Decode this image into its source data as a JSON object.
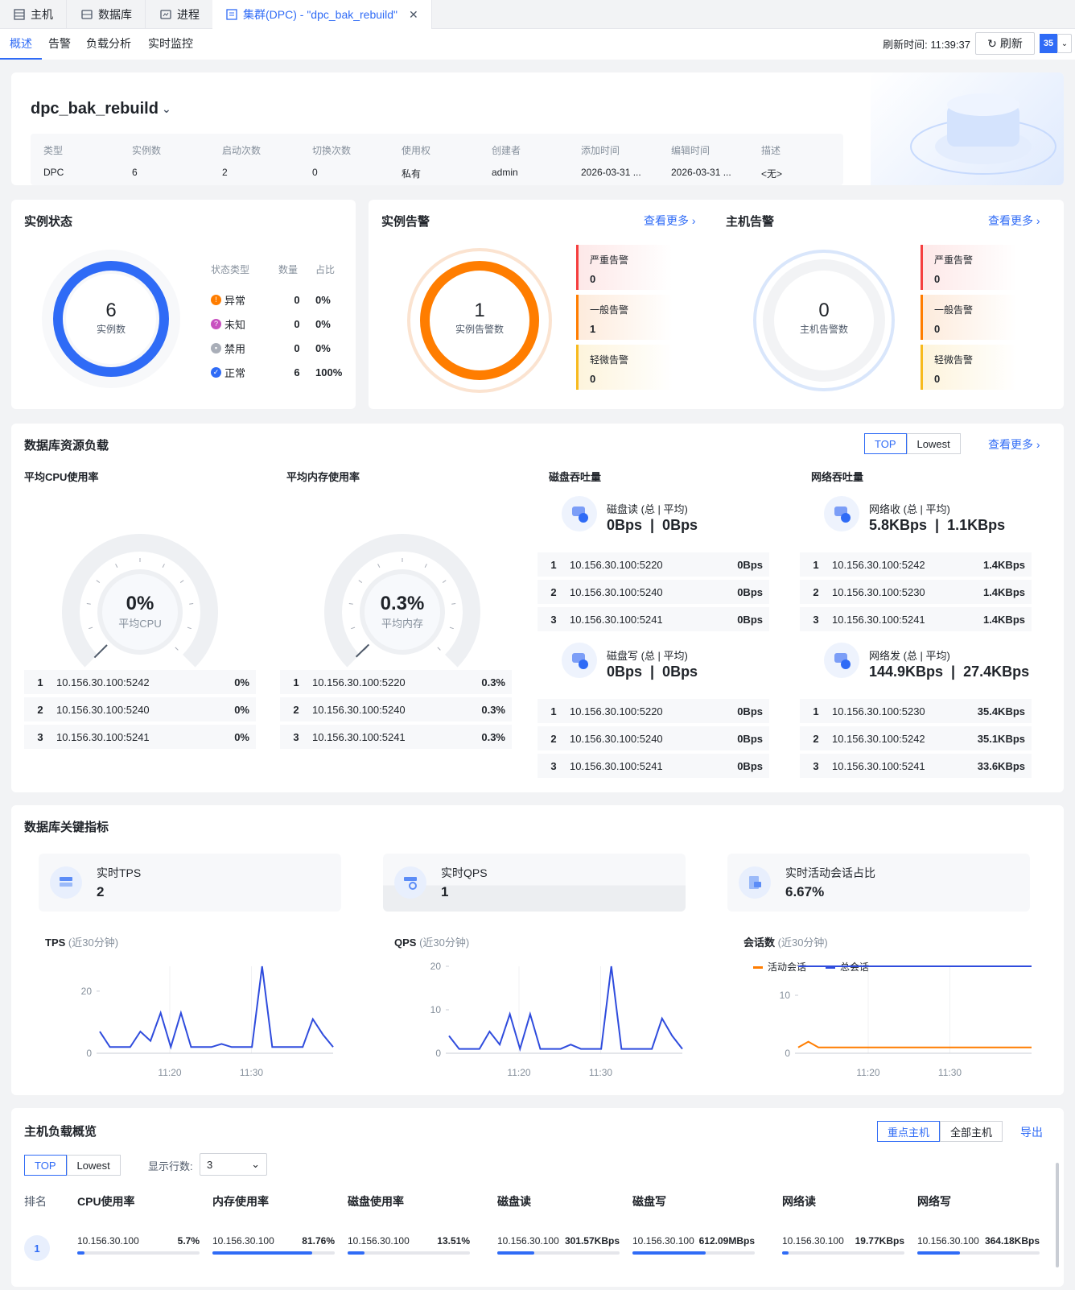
{
  "tabs": [
    {
      "label": "主机"
    },
    {
      "label": "数据库"
    },
    {
      "label": "进程"
    },
    {
      "label": "集群(DPC) - \"dpc_bak_rebuild\""
    }
  ],
  "subtabs": [
    "概述",
    "告警",
    "负载分析",
    "实时监控"
  ],
  "refresh": {
    "label": "刷新时间: 11:39:37",
    "button": "刷新",
    "interval": "35"
  },
  "cluster": {
    "name": "dpc_bak_rebuild",
    "info": [
      {
        "k": "类型",
        "v": "DPC"
      },
      {
        "k": "实例数",
        "v": "6"
      },
      {
        "k": "启动次数",
        "v": "2"
      },
      {
        "k": "切换次数",
        "v": "0"
      },
      {
        "k": "使用权",
        "v": "私有"
      },
      {
        "k": "创建者",
        "v": "admin"
      },
      {
        "k": "添加时间",
        "v": "2026-03-31 ..."
      },
      {
        "k": "编辑时间",
        "v": "2026-03-31 ..."
      },
      {
        "k": "描述",
        "v": "<无>"
      }
    ]
  },
  "instance_status": {
    "title": "实例状态",
    "count": "6",
    "count_label": "实例数",
    "headers": [
      "状态类型",
      "数量",
      "占比"
    ],
    "rows": [
      {
        "name": "异常",
        "count": "0",
        "pct": "0%",
        "color": "#ff7d00",
        "icon": "!"
      },
      {
        "name": "未知",
        "count": "0",
        "pct": "0%",
        "color": "#c850c0",
        "icon": "?"
      },
      {
        "name": "禁用",
        "count": "0",
        "pct": "0%",
        "color": "#a9aeb8",
        "icon": "▪"
      },
      {
        "name": "正常",
        "count": "6",
        "pct": "100%",
        "color": "#2f6bf6",
        "icon": "✓"
      }
    ]
  },
  "instance_alert": {
    "title": "实例告警",
    "more": "查看更多 ›",
    "count": "1",
    "count_label": "实例告警数",
    "items": [
      {
        "k": "严重告警",
        "v": "0"
      },
      {
        "k": "一般告警",
        "v": "1"
      },
      {
        "k": "轻微告警",
        "v": "0"
      }
    ]
  },
  "host_alert": {
    "title": "主机告警",
    "more": "查看更多 ›",
    "count": "0",
    "count_label": "主机告警数",
    "items": [
      {
        "k": "严重告警",
        "v": "0"
      },
      {
        "k": "一般告警",
        "v": "0"
      },
      {
        "k": "轻微告警",
        "v": "0"
      }
    ]
  },
  "db_load": {
    "title": "数据库资源负载",
    "seg": [
      "TOP",
      "Lowest"
    ],
    "more": "查看更多 ›",
    "cpu": {
      "title": "平均CPU使用率",
      "value": "0%",
      "label": "平均CPU",
      "level": 0,
      "rows": [
        {
          "r": "1",
          "ip": "10.156.30.100:5242",
          "v": "0%"
        },
        {
          "r": "2",
          "ip": "10.156.30.100:5240",
          "v": "0%"
        },
        {
          "r": "3",
          "ip": "10.156.30.100:5241",
          "v": "0%"
        }
      ]
    },
    "mem": {
      "title": "平均内存使用率",
      "value": "0.3%",
      "label": "平均内存",
      "level": 0.003,
      "rows": [
        {
          "r": "1",
          "ip": "10.156.30.100:5220",
          "v": "0.3%"
        },
        {
          "r": "2",
          "ip": "10.156.30.100:5240",
          "v": "0.3%"
        },
        {
          "r": "3",
          "ip": "10.156.30.100:5241",
          "v": "0.3%"
        }
      ]
    },
    "disk": {
      "title": "磁盘吞吐量",
      "read": {
        "label": "磁盘读 (总 | 平均)",
        "value": "0Bps  |  0Bps",
        "rows": [
          {
            "r": "1",
            "ip": "10.156.30.100:5220",
            "v": "0Bps"
          },
          {
            "r": "2",
            "ip": "10.156.30.100:5240",
            "v": "0Bps"
          },
          {
            "r": "3",
            "ip": "10.156.30.100:5241",
            "v": "0Bps"
          }
        ]
      },
      "write": {
        "label": "磁盘写 (总 | 平均)",
        "value": "0Bps  |  0Bps",
        "rows": [
          {
            "r": "1",
            "ip": "10.156.30.100:5220",
            "v": "0Bps"
          },
          {
            "r": "2",
            "ip": "10.156.30.100:5240",
            "v": "0Bps"
          },
          {
            "r": "3",
            "ip": "10.156.30.100:5241",
            "v": "0Bps"
          }
        ]
      }
    },
    "net": {
      "title": "网络吞吐量",
      "recv": {
        "label": "网络收 (总 | 平均)",
        "value": "5.8KBps  |  1.1KBps",
        "rows": [
          {
            "r": "1",
            "ip": "10.156.30.100:5242",
            "v": "1.4KBps"
          },
          {
            "r": "2",
            "ip": "10.156.30.100:5230",
            "v": "1.4KBps"
          },
          {
            "r": "3",
            "ip": "10.156.30.100:5241",
            "v": "1.4KBps"
          }
        ]
      },
      "send": {
        "label": "网络发 (总 | 平均)",
        "value": "144.9KBps  |  27.4KBps",
        "rows": [
          {
            "r": "1",
            "ip": "10.156.30.100:5230",
            "v": "35.4KBps"
          },
          {
            "r": "2",
            "ip": "10.156.30.100:5242",
            "v": "35.1KBps"
          },
          {
            "r": "3",
            "ip": "10.156.30.100:5241",
            "v": "33.6KBps"
          }
        ]
      }
    }
  },
  "key_metrics": {
    "title": "数据库关键指标",
    "kpis": [
      {
        "label": "实时TPS",
        "value": "2"
      },
      {
        "label": "实时QPS",
        "value": "1"
      },
      {
        "label": "实时活动会话占比",
        "value": "6.67%"
      }
    ],
    "tps_title": "TPS",
    "qps_title": "QPS",
    "sess_title": "会话数",
    "window": "(近30分钟)",
    "legend_active": "活动会话",
    "legend_total": "总会话"
  },
  "chart_data": [
    {
      "type": "line",
      "title": "TPS",
      "x": [
        "11:20",
        "11:30"
      ],
      "ylim": [
        0,
        28
      ],
      "yticks": [
        0,
        20
      ],
      "series": [
        {
          "values": [
            7,
            2,
            2,
            2,
            7,
            4,
            13,
            2,
            13,
            2,
            2,
            2,
            3,
            2,
            2,
            2,
            28,
            2,
            2,
            2,
            2,
            11,
            6,
            2
          ]
        }
      ]
    },
    {
      "type": "line",
      "title": "QPS",
      "x": [
        "11:20",
        "11:30"
      ],
      "ylim": [
        0,
        20
      ],
      "yticks": [
        0,
        10,
        20
      ],
      "series": [
        {
          "values": [
            4,
            1,
            1,
            1,
            5,
            2,
            9,
            1,
            9,
            1,
            1,
            1,
            2,
            1,
            1,
            1,
            20,
            1,
            1,
            1,
            1,
            8,
            4,
            1
          ]
        }
      ]
    },
    {
      "type": "line",
      "title": "会话数",
      "x": [
        "11:20",
        "11:30"
      ],
      "ylim": [
        0,
        15
      ],
      "yticks": [
        0,
        10
      ],
      "series": [
        {
          "name": "活动会话",
          "values": [
            1,
            2,
            1,
            1,
            1,
            1,
            1,
            1,
            1,
            1,
            1,
            1,
            1,
            1,
            1,
            1,
            1,
            1,
            1,
            1,
            1,
            1,
            1,
            1
          ]
        },
        {
          "name": "总会话",
          "values": [
            15,
            15,
            15,
            15,
            15,
            15,
            15,
            15,
            15,
            15,
            15,
            15,
            15,
            15,
            15,
            15,
            15,
            15,
            15,
            15,
            15,
            15,
            15,
            15
          ]
        }
      ]
    }
  ],
  "host_load": {
    "title": "主机负载概览",
    "seg": [
      "重点主机",
      "全部主机"
    ],
    "export": "导出",
    "seg2": [
      "TOP",
      "Lowest"
    ],
    "rows_label": "显示行数:",
    "rows_value": "3",
    "cols": [
      "排名",
      "CPU使用率",
      "内存使用率",
      "磁盘使用率",
      "磁盘读",
      "磁盘写",
      "网络读",
      "网络写"
    ],
    "rank": "1",
    "cells": [
      {
        "ip": "10.156.30.100",
        "v": "5.7%",
        "level": 0.057
      },
      {
        "ip": "10.156.30.100",
        "v": "81.76%",
        "level": 0.8176
      },
      {
        "ip": "10.156.30.100",
        "v": "13.51%",
        "level": 0.1351
      },
      {
        "ip": "10.156.30.100",
        "v": "301.57KBps",
        "level": 0.3
      },
      {
        "ip": "10.156.30.100",
        "v": "612.09MBps",
        "level": 0.6
      },
      {
        "ip": "10.156.30.100",
        "v": "19.77KBps",
        "level": 0.05
      },
      {
        "ip": "10.156.30.100",
        "v": "364.18KBps",
        "level": 0.35
      }
    ]
  }
}
